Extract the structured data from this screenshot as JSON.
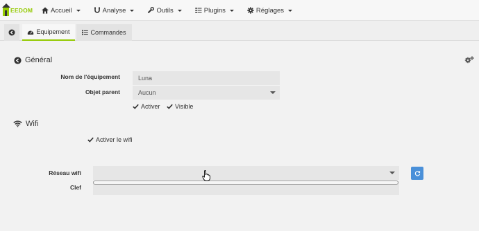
{
  "brand": {
    "logo_text": "EEDOM",
    "accent": "#94ca02"
  },
  "nav": {
    "items": [
      {
        "label": "Accueil",
        "icon": "home-icon"
      },
      {
        "label": "Analyse",
        "icon": "analyse-icon"
      },
      {
        "label": "Outils",
        "icon": "wrench-icon"
      },
      {
        "label": "Plugins",
        "icon": "list-icon"
      },
      {
        "label": "Réglages",
        "icon": "gear-icon"
      }
    ]
  },
  "tabs": {
    "back_icon": "arrow-left-circle-icon",
    "equipement": "Equipement",
    "commandes": "Commandes"
  },
  "general": {
    "title": "Général",
    "name_label": "Nom de l'équipement",
    "name_value": "Luna",
    "parent_label": "Objet parent",
    "parent_value": "Aucun",
    "activer_label": "Activer",
    "visible_label": "Visible"
  },
  "wifi": {
    "title": "Wifi",
    "enable_label": "Activer le wifi",
    "network_label": "Réseau wifi",
    "network_value": "",
    "key_label": "Clef",
    "key_value": ""
  },
  "colors": {
    "refresh_button": "#4a90d9"
  }
}
